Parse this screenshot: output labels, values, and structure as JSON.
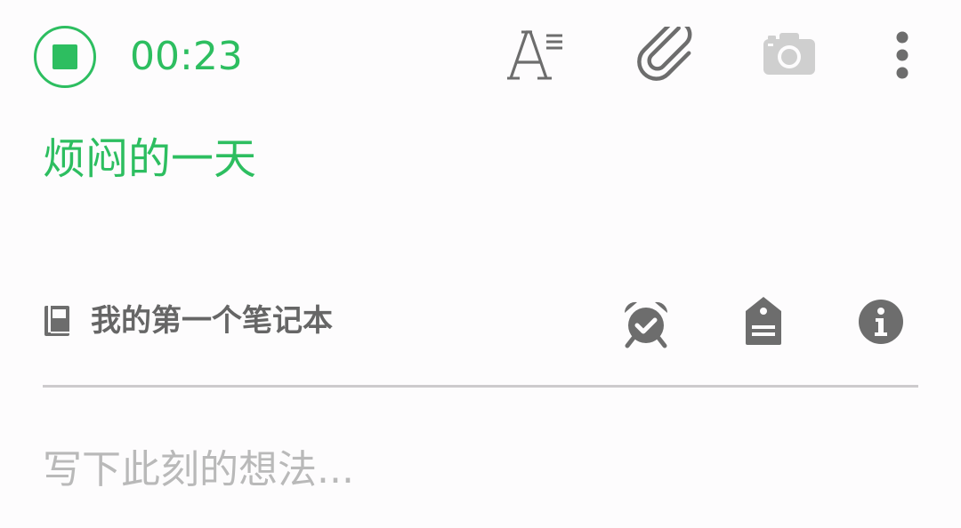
{
  "recording": {
    "elapsed": "00:23"
  },
  "toolbar": {
    "icons": [
      "stop-record-icon",
      "text-format-icon",
      "paperclip-icon",
      "camera-icon",
      "more-vertical-icon"
    ]
  },
  "note": {
    "title": "烦闷的一天",
    "body_placeholder": "写下此刻的想法..."
  },
  "notebook": {
    "name": "我的第一个笔记本",
    "icons": [
      "notebook-icon",
      "alarm-clock-icon",
      "tag-icon",
      "info-icon"
    ]
  },
  "colors": {
    "accent": "#2dbe60",
    "icon_dark": "#6d6d6d",
    "icon_disabled": "#cfcfcf",
    "divider": "#cdcbcd",
    "placeholder": "#b9b9b9"
  }
}
